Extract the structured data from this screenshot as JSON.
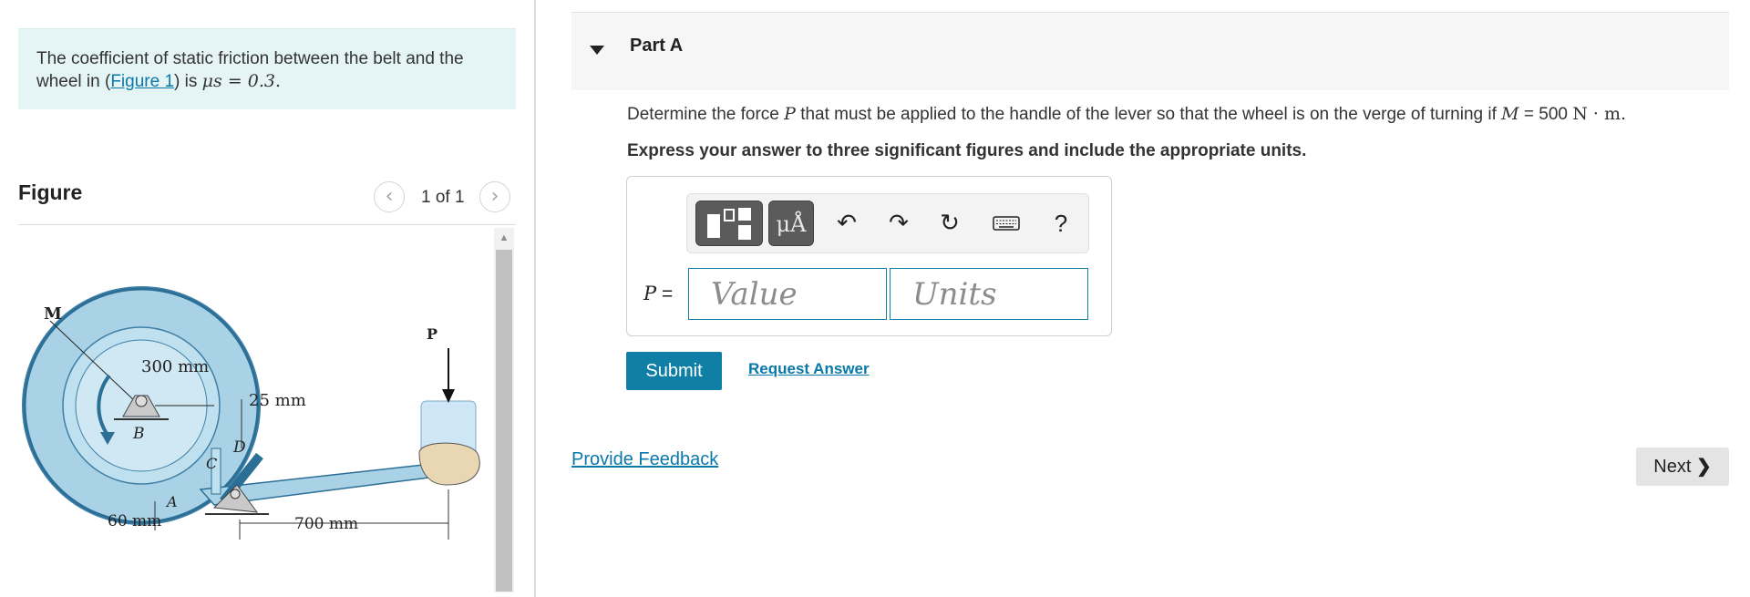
{
  "intro": {
    "text_before": "The coefficient of static friction between the belt and the wheel in (",
    "figure_link": "Figure 1",
    "text_after": ") is ",
    "math": "μs = 0.3."
  },
  "figure": {
    "heading": "Figure",
    "counter": "1 of 1",
    "prev_icon": "chevron-left-icon",
    "next_icon": "chevron-right-icon",
    "labels": {
      "moment": "M",
      "radius": "300 mm",
      "gap": "25 mm",
      "point_b": "B",
      "point_c": "C",
      "point_d": "D",
      "point_a": "A",
      "force": "P",
      "offset": "60 mm",
      "lever_length": "700 mm"
    },
    "colors": {
      "wheel": "#a9d2e6",
      "wheel_dark": "#4a90b8",
      "lever": "#a9d2e6",
      "hand": "#e9d6b3"
    }
  },
  "part": {
    "title": "Part A",
    "caret_icon": "caret-down-icon",
    "question_before": "Determine the force ",
    "question_var": "P",
    "question_middle": " that must be applied to the handle of the lever so that the wheel is on the verge of turning if ",
    "question_m": "M",
    "question_value": " = 500 ",
    "question_units": "N · m.",
    "instruction": "Express your answer to three significant figures and include the appropriate units."
  },
  "answer": {
    "label": "P",
    "equals": " =",
    "value_placeholder": "Value",
    "units_placeholder": "Units",
    "toolbar": {
      "templates_icon": "templates-icon",
      "units_label": "μÅ",
      "undo_icon": "undo-icon",
      "redo_icon": "redo-icon",
      "reset_icon": "reset-icon",
      "keyboard_icon": "keyboard-icon",
      "help_label": "?"
    }
  },
  "actions": {
    "submit": "Submit",
    "request_answer": "Request Answer",
    "provide_feedback": "Provide Feedback",
    "next": "Next"
  },
  "colors": {
    "accent": "#0f7fa6",
    "link": "#0a78a8",
    "intro_bg": "#e5f4f5"
  }
}
